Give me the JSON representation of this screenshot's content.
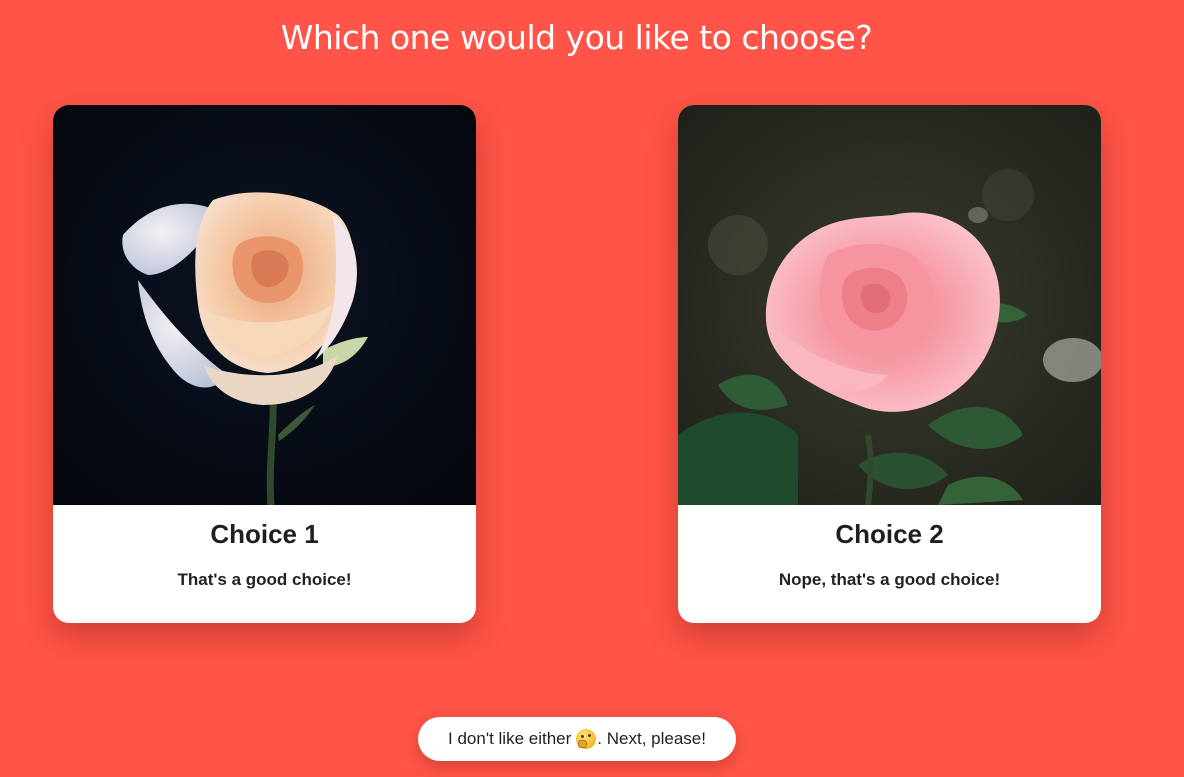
{
  "page": {
    "heading": "Which one would you like to choose?",
    "background_color": "#ff5447"
  },
  "choices": [
    {
      "title": "Choice 1",
      "text": "That's a good choice!",
      "image": "peach-rose-on-dark-background"
    },
    {
      "title": "Choice 2",
      "text": "Nope, that's a good choice!",
      "image": "pink-rose-with-green-leaves"
    }
  ],
  "next_button": {
    "label_before": "I don't like either",
    "emoji": "thinking-face-icon",
    "label_after": ". Next, please!"
  }
}
